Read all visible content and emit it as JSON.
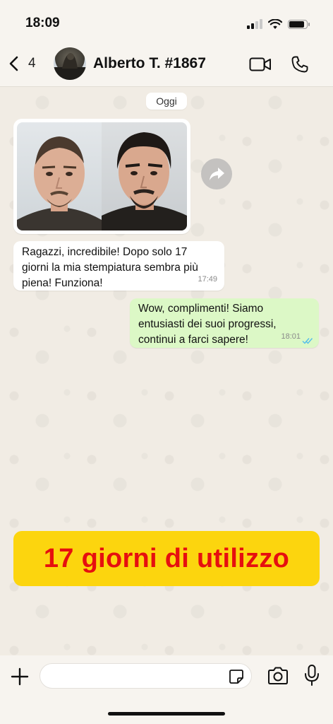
{
  "status_bar": {
    "time": "18:09",
    "signal_bars": 2,
    "battery_level": 0.8
  },
  "header": {
    "back_count": "4",
    "contact_name": "Alberto T. #1867"
  },
  "chat": {
    "date_label": "Oggi",
    "image_message": {
      "left_photo": "before-photo",
      "right_photo": "after-photo"
    },
    "incoming": {
      "text": "Ragazzi, incredibile! Dopo solo 17 giorni la mia stempiatura sembra più piena! Funziona!",
      "time": "17:49"
    },
    "outgoing": {
      "text": "Wow, complimenti! Siamo entusiasti dei suoi progressi, continui a farci sapere!",
      "time": "18:01",
      "status": "read"
    }
  },
  "banner": {
    "text": "17 giorni di utilizzo",
    "bg_color": "#fcd50e",
    "text_color": "#e60f0f"
  },
  "composer": {
    "placeholder": "",
    "value": ""
  },
  "colors": {
    "outgoing_bubble": "#dcf8c6",
    "incoming_bubble": "#ffffff",
    "read_ticks": "#53bdeb"
  }
}
